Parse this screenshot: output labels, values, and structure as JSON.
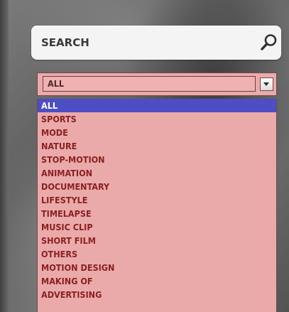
{
  "search": {
    "placeholder": "SEARCH"
  },
  "icons": {
    "search": "search-icon",
    "dropdown": "chevron-down-icon"
  },
  "category_select": {
    "selected_value": "ALL",
    "options": [
      "ALL",
      "SPORTS",
      "MODE",
      "NATURE",
      "STOP-MOTION",
      "ANIMATION",
      "DOCUMENTARY",
      "LIFESTYLE",
      "TIMELAPSE",
      "MUSIC CLIP",
      "SHORT FILM",
      "OTHERS",
      "MOTION DESIGN",
      "MAKING OF",
      "ADVERTISING"
    ],
    "highlighted_index": 0
  },
  "colors": {
    "select_background": "#ebaaaa",
    "option_text": "#8a2121",
    "highlight_background": "#4d4dc4",
    "highlight_text": "#ffffff",
    "search_background": "#f4f4f4"
  }
}
